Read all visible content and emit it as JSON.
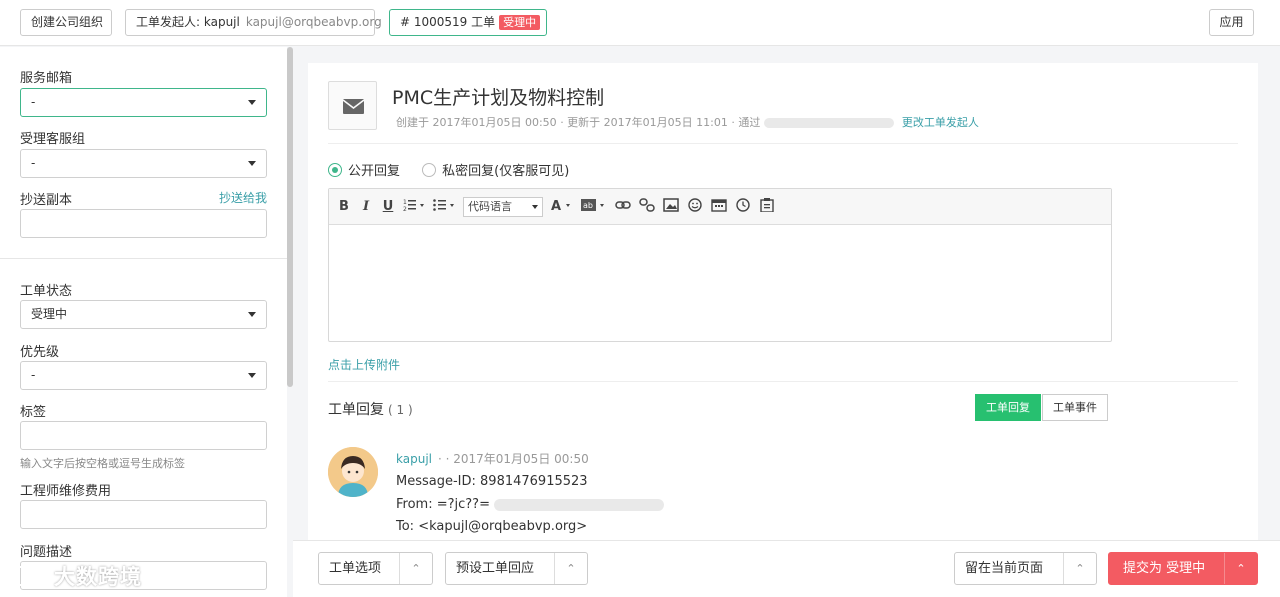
{
  "topbar": {
    "create_company": "创建公司组织",
    "requester_label": "工单发起人: kapujl",
    "requester_email": "kapujl@orqbeabvp.org",
    "ticket_number": "# 1000519 工单",
    "ticket_status": "受理中",
    "apply": "应用"
  },
  "sidebar": {
    "mailbox_label": "服务邮箱",
    "mailbox_value": "-",
    "group_label": "受理客服组",
    "group_value": "-",
    "cc_label": "抄送副本",
    "cc_link": "抄送给我",
    "cc_value": "",
    "status_label": "工单状态",
    "status_value": "受理中",
    "priority_label": "优先级",
    "priority_value": "-",
    "tags_label": "标签",
    "tags_value": "",
    "tags_hint": "输入文字后按空格或逗号生成标签",
    "fee_label": "工程师维修费用",
    "fee_value": "",
    "desc_label": "问题描述",
    "desc_value": ""
  },
  "ticket": {
    "title": "PMC生产计划及物料控制",
    "created": "创建于 2017年01月05日 00:50",
    "updated": "· 更新于 2017年01月05日 11:01",
    "via": "· 通过",
    "change_requester": "更改工单发起人"
  },
  "reply_form": {
    "public": "公开回复",
    "private": "私密回复(仅客服可见)",
    "code_lang": "代码语言",
    "upload": "点击上传附件"
  },
  "toolbar_icons": [
    "bold-icon",
    "italic-icon",
    "underline-icon",
    "ordered-list-icon",
    "unordered-list-icon",
    "font-color-icon",
    "highlight-icon",
    "link-icon",
    "unlink-icon",
    "image-icon",
    "emoji-icon",
    "date-icon",
    "time-icon",
    "paste-icon"
  ],
  "replies": {
    "title": "工单回复",
    "count": "( 1 )",
    "tab_replies": "工单回复",
    "tab_events": "工单事件",
    "author": "kapujl",
    "time": "· · 2017年01月05日 00:50",
    "message_id": "Message-ID: 8981476915523",
    "from": "From: =?jc??=",
    "to": "To: <kapujl@orqbeabvp.org>"
  },
  "bottombar": {
    "ticket_options": "工单选项",
    "preset_reply": "预设工单回应",
    "stay_on_page": "留在当前页面",
    "submit": "提交为 受理中"
  },
  "watermark": "大数跨境",
  "colors": {
    "accent_green": "#27c070",
    "link_teal": "#3a9fa8",
    "status_red": "#f35b62"
  }
}
